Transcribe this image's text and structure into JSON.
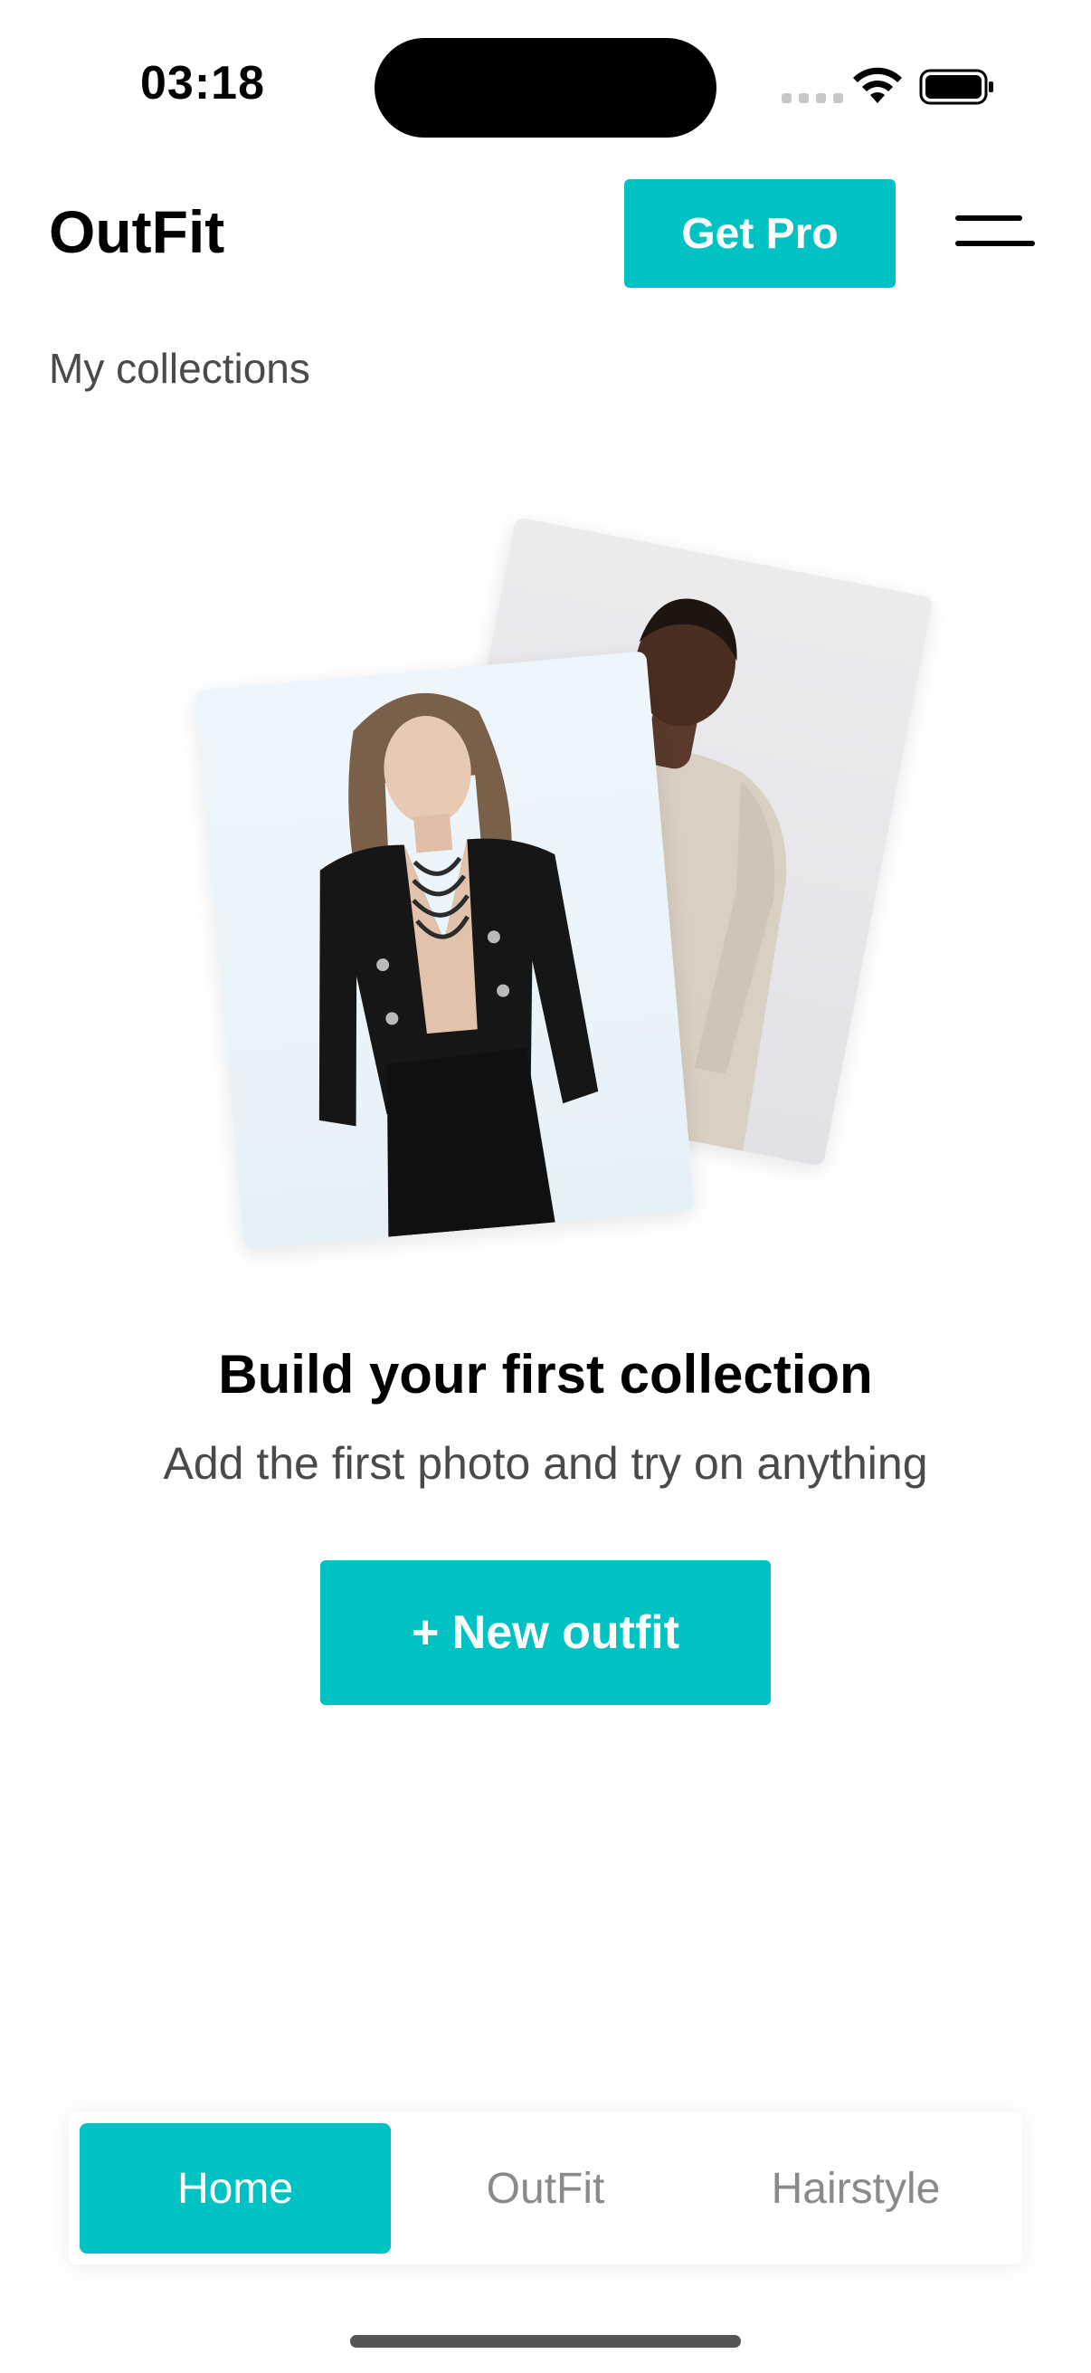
{
  "status_bar": {
    "time": "03:18"
  },
  "header": {
    "app_title": "OutFit",
    "get_pro_label": "Get Pro",
    "menu_icon": "hamburger-menu-icon"
  },
  "section": {
    "subtitle": "My collections"
  },
  "empty_state": {
    "title": "Build your first collection",
    "description": "Add the first photo and try on anything",
    "cta_label": "+ New outfit"
  },
  "tabbar": {
    "active_index": 0,
    "tabs": [
      {
        "label": "Home"
      },
      {
        "label": "OutFit"
      },
      {
        "label": "Hairstyle"
      }
    ]
  },
  "colors": {
    "accent": "#00c2c2",
    "text_primary": "#000000",
    "text_secondary": "#4a4a4a",
    "tab_inactive": "#8a8a8a"
  }
}
